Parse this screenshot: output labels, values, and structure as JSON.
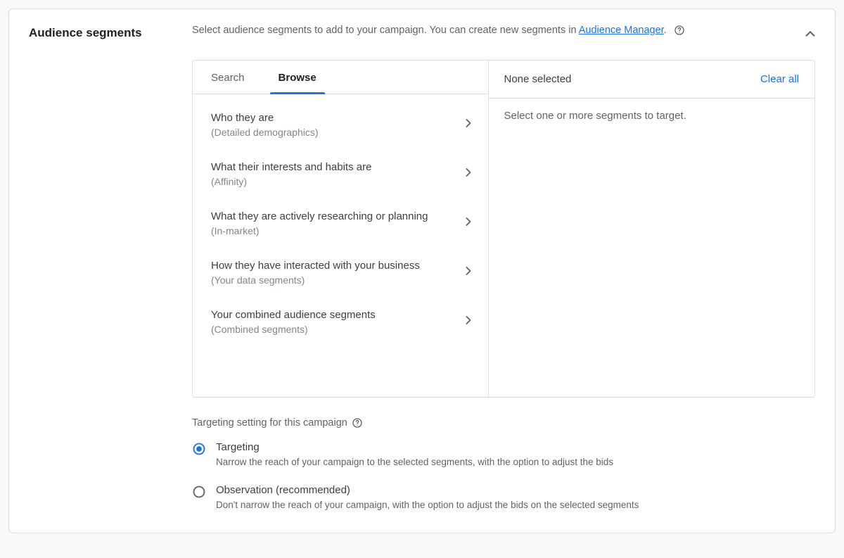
{
  "section_title": "Audience segments",
  "intro_pre": "Select audience segments to add to your campaign. You can create new segments in ",
  "intro_link": "Audience Manager",
  "intro_post": ".",
  "tabs": {
    "search": "Search",
    "browse": "Browse",
    "active": "browse"
  },
  "categories": [
    {
      "title": "Who they are",
      "sub": "(Detailed demographics)"
    },
    {
      "title": "What their interests and habits are",
      "sub": "(Affinity)"
    },
    {
      "title": "What they are actively researching or planning",
      "sub": "(In-market)"
    },
    {
      "title": "How they have interacted with your business",
      "sub": "(Your data segments)"
    },
    {
      "title": "Your combined audience segments",
      "sub": "(Combined segments)"
    }
  ],
  "right_panel": {
    "header": "None selected",
    "clear": "Clear all",
    "placeholder": "Select one or more segments to target."
  },
  "targeting": {
    "label": "Targeting setting for this campaign",
    "options": [
      {
        "title": "Targeting",
        "desc": "Narrow the reach of your campaign to the selected segments, with the option to adjust the bids",
        "selected": true
      },
      {
        "title": "Observation (recommended)",
        "desc": "Don't narrow the reach of your campaign, with the option to adjust the bids on the selected segments",
        "selected": false
      }
    ]
  }
}
